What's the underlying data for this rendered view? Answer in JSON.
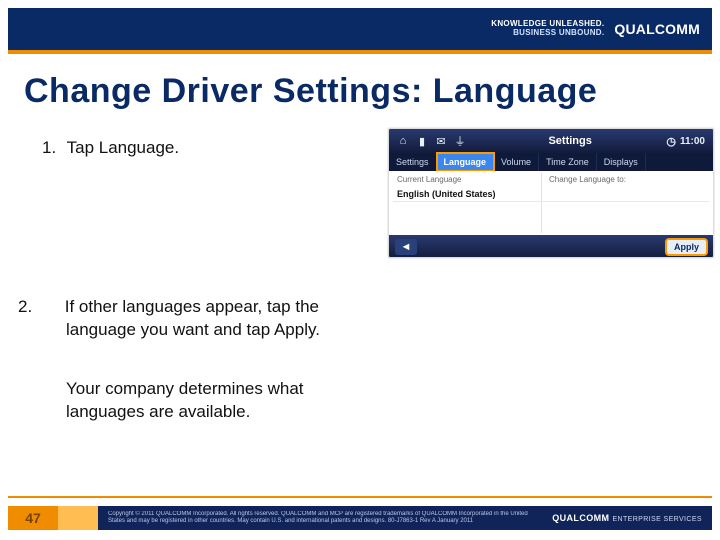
{
  "brand": {
    "tagline_line1": "KNOWLEDGE UNLEASHED.",
    "tagline_line2": "BUSINESS UNBOUND.",
    "name": "QUALCOMM"
  },
  "title": "Change Driver Settings: Language",
  "steps": {
    "s1_num": "1.",
    "s1_text": "Tap Language.",
    "s2_num": "2.",
    "s2_text": "If other languages appear, tap the language you want and tap Apply.",
    "note": "Your company determines what languages are available."
  },
  "shot": {
    "title": "Settings",
    "clock": "11:00",
    "tabs": [
      "Settings",
      "Language",
      "Volume",
      "Time Zone",
      "Displays"
    ],
    "col_left_label": "Current Language",
    "col_right_label": "Change Language to:",
    "current_value": "English (United States)",
    "apply_label": "Apply"
  },
  "footer": {
    "page": "47",
    "copyright": "Copyright © 2011 QUALCOMM Incorporated. All rights reserved. QUALCOMM and MCP are registered trademarks of QUALCOMM Incorporated in the United States and may be registered in other countries. May contain U.S. and international patents and designs. 80-J7863-1 Rev A  January 2011",
    "brand_main": "QUALCOMM",
    "brand_sub": "ENTERPRISE SERVICES"
  }
}
